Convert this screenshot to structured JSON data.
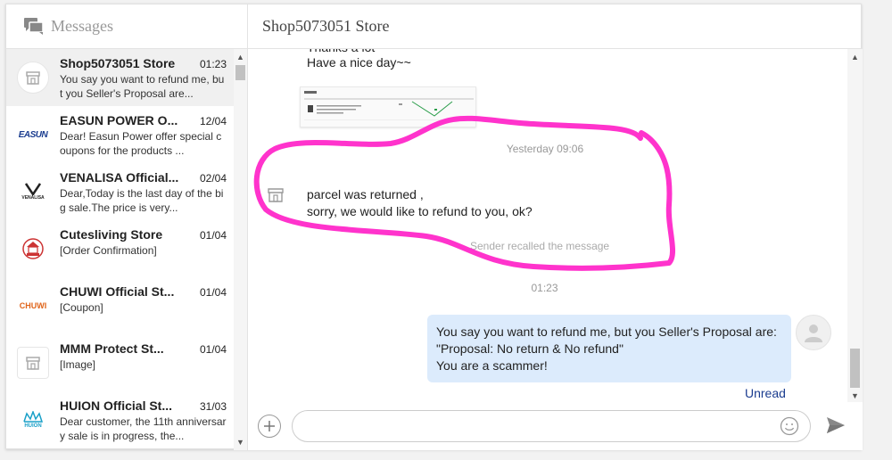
{
  "sidebar": {
    "title": "Messages",
    "conversations": [
      {
        "name": "Shop5073051 Store",
        "date": "01:23",
        "preview": "You say you want to refund me, but you Seller's Proposal are...",
        "logo": "store-icon"
      },
      {
        "name": "EASUN POWER O...",
        "date": "12/04",
        "preview": "Dear! Easun Power offer special coupons for the products ...",
        "logo_text": "EASUN"
      },
      {
        "name": "VENALISA Official...",
        "date": "02/04",
        "preview": "Dear,Today is the last day of the big sale.The price is very...",
        "logo_text": "VENALISA"
      },
      {
        "name": "Cutesliving Store",
        "date": "01/04",
        "preview": "[Order Confirmation]",
        "logo": "cutesliving-logo"
      },
      {
        "name": "CHUWI Official St...",
        "date": "01/04",
        "preview": "[Coupon]",
        "logo_text": "CHUWI"
      },
      {
        "name": "MMM Protect St...",
        "date": "01/04",
        "preview": "[Image]",
        "logo": "store-icon"
      },
      {
        "name": "HUION Official St...",
        "date": "31/03",
        "preview": "Dear customer, the 11th anniversary sale is in progress, the...",
        "logo_text": "HUION"
      }
    ]
  },
  "chat": {
    "store_name": "Shop5073051 Store",
    "partial_line": "Thanks a lot",
    "line_have_nice_day": "Have a nice day~~",
    "timestamp_yesterday": "Yesterday 09:06",
    "seller_msg_line1": "parcel was returned ,",
    "seller_msg_line2": "sorry, we would like to refund to you, ok?",
    "recalled": "Sender recalled the message",
    "timestamp_recent": "01:23",
    "my_msg_line1": "You say you want to refund me, but you Seller's Proposal are:",
    "my_msg_line2": "\"Proposal: No return & No refund\"",
    "my_msg_line3": "You are a scammer!",
    "unread": "Unread"
  },
  "colors": {
    "highlight": "#ff33cc",
    "bubble": "#dcebfc",
    "unread": "#1a3c8f"
  }
}
